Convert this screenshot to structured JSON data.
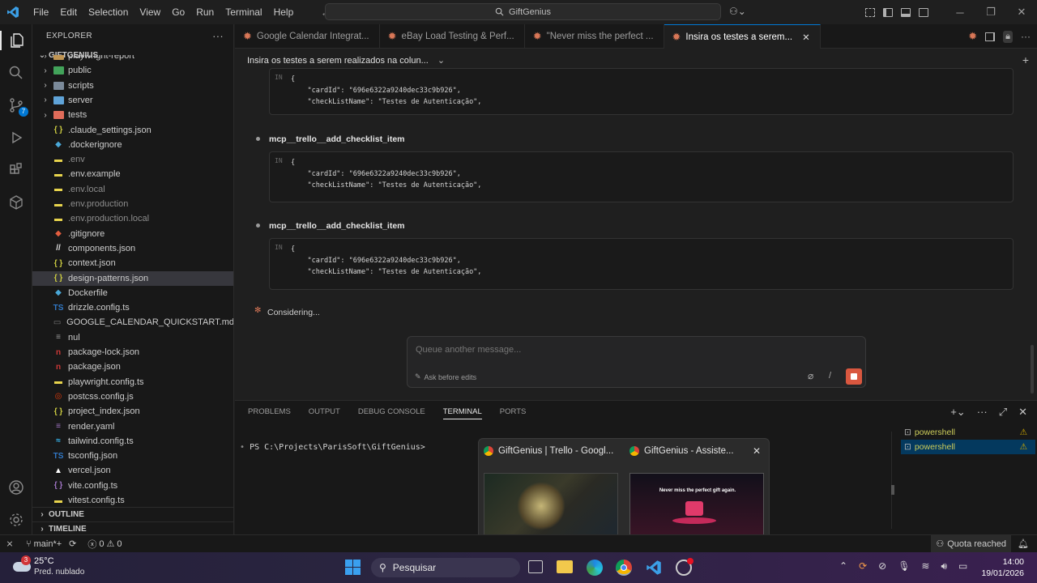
{
  "menu": [
    "File",
    "Edit",
    "Selection",
    "View",
    "Go",
    "Run",
    "Terminal",
    "Help"
  ],
  "command_center": "GiftGenius",
  "explorer": {
    "header": "EXPLORER",
    "root": "GIFTGENIUS",
    "items": [
      {
        "label": "playwright-report",
        "type": "folder",
        "icon_color": "#c09553"
      },
      {
        "label": "public",
        "type": "folder",
        "icon_color": "#42a35a"
      },
      {
        "label": "scripts",
        "type": "folder",
        "icon_color": "#7b8a9a"
      },
      {
        "label": "server",
        "type": "folder",
        "icon_color": "#5fa3d8"
      },
      {
        "label": "tests",
        "type": "folder",
        "icon_color": "#e06c5a"
      },
      {
        "label": ".claude_settings.json",
        "type": "json",
        "glyph": "{ }",
        "icon_color": "#cbcb41"
      },
      {
        "label": ".dockerignore",
        "type": "docker",
        "glyph": "◆",
        "icon_color": "#4aa8d8"
      },
      {
        "label": ".env",
        "type": "env",
        "glyph": "▬",
        "icon_color": "#e8d44d",
        "dim": true
      },
      {
        "label": ".env.example",
        "type": "env",
        "glyph": "▬",
        "icon_color": "#e8d44d"
      },
      {
        "label": ".env.local",
        "type": "env",
        "glyph": "▬",
        "icon_color": "#e8d44d",
        "dim": true
      },
      {
        "label": ".env.production",
        "type": "env",
        "glyph": "▬",
        "icon_color": "#e8d44d",
        "dim": true
      },
      {
        "label": ".env.production.local",
        "type": "env",
        "glyph": "▬",
        "icon_color": "#e8d44d",
        "dim": true
      },
      {
        "label": ".gitignore",
        "type": "git",
        "glyph": "◆",
        "icon_color": "#e35d3f"
      },
      {
        "label": "components.json",
        "type": "json",
        "glyph": "//",
        "icon_color": "#e0e0e0"
      },
      {
        "label": "context.json",
        "type": "json",
        "glyph": "{ }",
        "icon_color": "#cbcb41"
      },
      {
        "label": "design-patterns.json",
        "type": "json",
        "glyph": "{ }",
        "icon_color": "#cbcb41",
        "selected": true
      },
      {
        "label": "Dockerfile",
        "type": "docker",
        "glyph": "◆",
        "icon_color": "#4aa8d8"
      },
      {
        "label": "drizzle.config.ts",
        "type": "ts",
        "glyph": "TS",
        "icon_color": "#3178c6"
      },
      {
        "label": "GOOGLE_CALENDAR_QUICKSTART.md",
        "type": "md",
        "glyph": "▭",
        "icon_color": "#7a7a7a"
      },
      {
        "label": "nul",
        "type": "file",
        "glyph": "≡",
        "icon_color": "#9a9a9a"
      },
      {
        "label": "package-lock.json",
        "type": "npm",
        "glyph": "n",
        "icon_color": "#cb3837"
      },
      {
        "label": "package.json",
        "type": "npm",
        "glyph": "n",
        "icon_color": "#cb3837"
      },
      {
        "label": "playwright.config.ts",
        "type": "ts",
        "glyph": "▬",
        "icon_color": "#e8d44d"
      },
      {
        "label": "postcss.config.js",
        "type": "js",
        "glyph": "◎",
        "icon_color": "#dd3a0a"
      },
      {
        "label": "project_index.json",
        "type": "json",
        "glyph": "{ }",
        "icon_color": "#cbcb41"
      },
      {
        "label": "render.yaml",
        "type": "yaml",
        "glyph": "≡",
        "icon_color": "#a074c4"
      },
      {
        "label": "tailwind.config.ts",
        "type": "ts",
        "glyph": "≈",
        "icon_color": "#38bdf8"
      },
      {
        "label": "tsconfig.json",
        "type": "ts",
        "glyph": "TS",
        "icon_color": "#3178c6"
      },
      {
        "label": "vercel.json",
        "type": "file",
        "glyph": "▲",
        "icon_color": "#ffffff"
      },
      {
        "label": "vite.config.ts",
        "type": "ts",
        "glyph": "{ }",
        "icon_color": "#a074c4"
      },
      {
        "label": "vitest.config.ts",
        "type": "ts",
        "glyph": "▬",
        "icon_color": "#e8d44d"
      }
    ],
    "outline": "OUTLINE",
    "timeline": "TIMELINE"
  },
  "tabs": [
    {
      "label": "Google Calendar Integrat...",
      "active": false
    },
    {
      "label": "eBay Load Testing & Perf...",
      "active": false
    },
    {
      "label": "\"Never miss the perfect ...",
      "active": false
    },
    {
      "label": "Insira os testes a serem...",
      "active": true
    }
  ],
  "chat": {
    "title": "Insira os testes a serem realizados na colun...",
    "in_label": "IN",
    "code_lines": [
      "{",
      "\"cardId\": \"696e6322a9240dec33c9b926\",",
      "\"checkListName\": \"Testes de Autenticação\","
    ],
    "tool_name": "mcp__trello__add_checklist_item",
    "status": "Considering...",
    "queue_placeholder": "Queue another message...",
    "ask_before_edits": "Ask before edits"
  },
  "panel": {
    "tabs": [
      "PROBLEMS",
      "OUTPUT",
      "DEBUG CONSOLE",
      "TERMINAL",
      "PORTS"
    ],
    "active_tab": "TERMINAL",
    "prompt": "PS C:\\Projects\\ParisSoft\\GiftGenius>",
    "terminals": [
      "powershell",
      "powershell"
    ]
  },
  "preview": {
    "windows": [
      {
        "title": "GiftGenius | Trello - Googl..."
      },
      {
        "title": "GiftGenius - Assiste..."
      }
    ],
    "thumb_text": "Never miss the perfect gift again."
  },
  "status_bar": {
    "branch": "main*+",
    "errors": "0",
    "warnings": "0",
    "quota": "Quota reached"
  },
  "taskbar": {
    "weather_temp": "25°C",
    "weather_desc": "Pred. nublado",
    "weather_badge": "3",
    "search": "Pesquisar",
    "time": "14:00",
    "date": "19/01/2026"
  }
}
